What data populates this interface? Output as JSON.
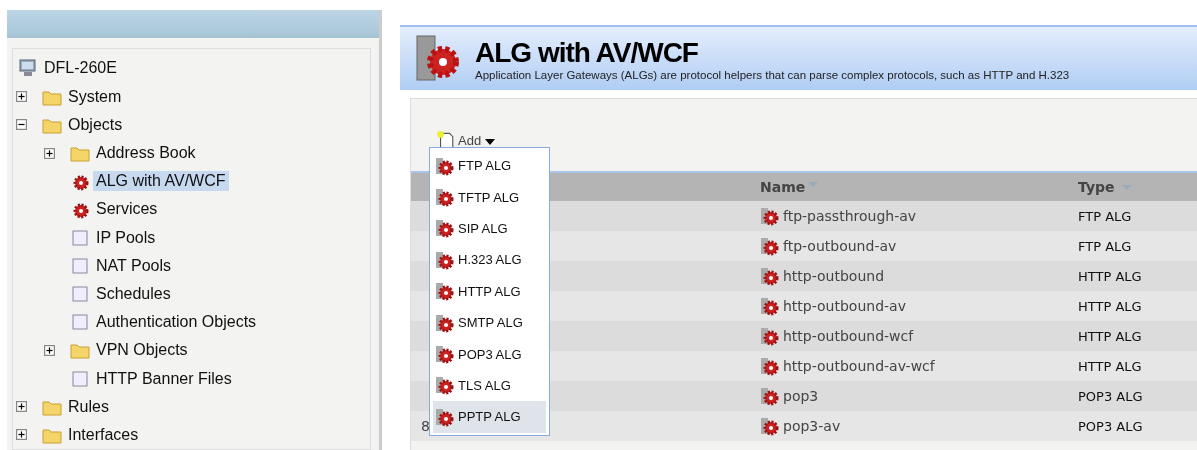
{
  "tree": {
    "label": "DFL-260E",
    "children": [
      {
        "label": "System",
        "kind": "folder",
        "expanded": false,
        "selected": false
      },
      {
        "label": "Objects",
        "kind": "folder",
        "expanded": true,
        "selected": false,
        "children": [
          {
            "label": "Address Book",
            "kind": "folder",
            "expanded": false,
            "selected": false
          },
          {
            "label": "ALG with AV/WCF",
            "kind": "alg",
            "selected": true
          },
          {
            "label": "Services",
            "kind": "alg",
            "selected": false
          },
          {
            "label": "IP Pools",
            "kind": "item",
            "selected": false
          },
          {
            "label": "NAT Pools",
            "kind": "item",
            "selected": false
          },
          {
            "label": "Schedules",
            "kind": "item",
            "selected": false
          },
          {
            "label": "Authentication Objects",
            "kind": "item",
            "selected": false
          },
          {
            "label": "VPN Objects",
            "kind": "folder",
            "expanded": false,
            "selected": false
          },
          {
            "label": "HTTP Banner Files",
            "kind": "item",
            "selected": false
          }
        ]
      },
      {
        "label": "Rules",
        "kind": "folder",
        "expanded": false,
        "selected": false
      },
      {
        "label": "Interfaces",
        "kind": "folder",
        "expanded": false,
        "selected": false
      }
    ]
  },
  "page": {
    "title": "ALG with AV/WCF",
    "description": "Application Layer Gateways (ALGs) are protocol helpers that can parse complex protocols, such as HTTP and H.323"
  },
  "add_button": {
    "label": "Add"
  },
  "add_menu": [
    {
      "label": "FTP ALG",
      "selected": false
    },
    {
      "label": "TFTP ALG",
      "selected": false
    },
    {
      "label": "SIP ALG",
      "selected": false
    },
    {
      "label": "H.323 ALG",
      "selected": false
    },
    {
      "label": "HTTP ALG",
      "selected": false
    },
    {
      "label": "SMTP ALG",
      "selected": false
    },
    {
      "label": "POP3 ALG",
      "selected": false
    },
    {
      "label": "TLS ALG",
      "selected": false
    },
    {
      "label": "PPTP ALG",
      "selected": true
    }
  ],
  "table": {
    "columns": [
      "Name",
      "Type"
    ],
    "rows": [
      {
        "name": "ftp-passthrough-av",
        "type": "FTP ALG"
      },
      {
        "name": "ftp-outbound-av",
        "type": "FTP ALG"
      },
      {
        "name": "http-outbound",
        "type": "HTTP ALG"
      },
      {
        "name": "http-outbound-av",
        "type": "HTTP ALG"
      },
      {
        "name": "http-outbound-wcf",
        "type": "HTTP ALG"
      },
      {
        "name": "http-outbound-av-wcf",
        "type": "HTTP ALG"
      },
      {
        "name": "pop3",
        "type": "POP3 ALG"
      },
      {
        "index": "8",
        "name": "pop3-av",
        "type": "POP3 ALG"
      }
    ]
  }
}
